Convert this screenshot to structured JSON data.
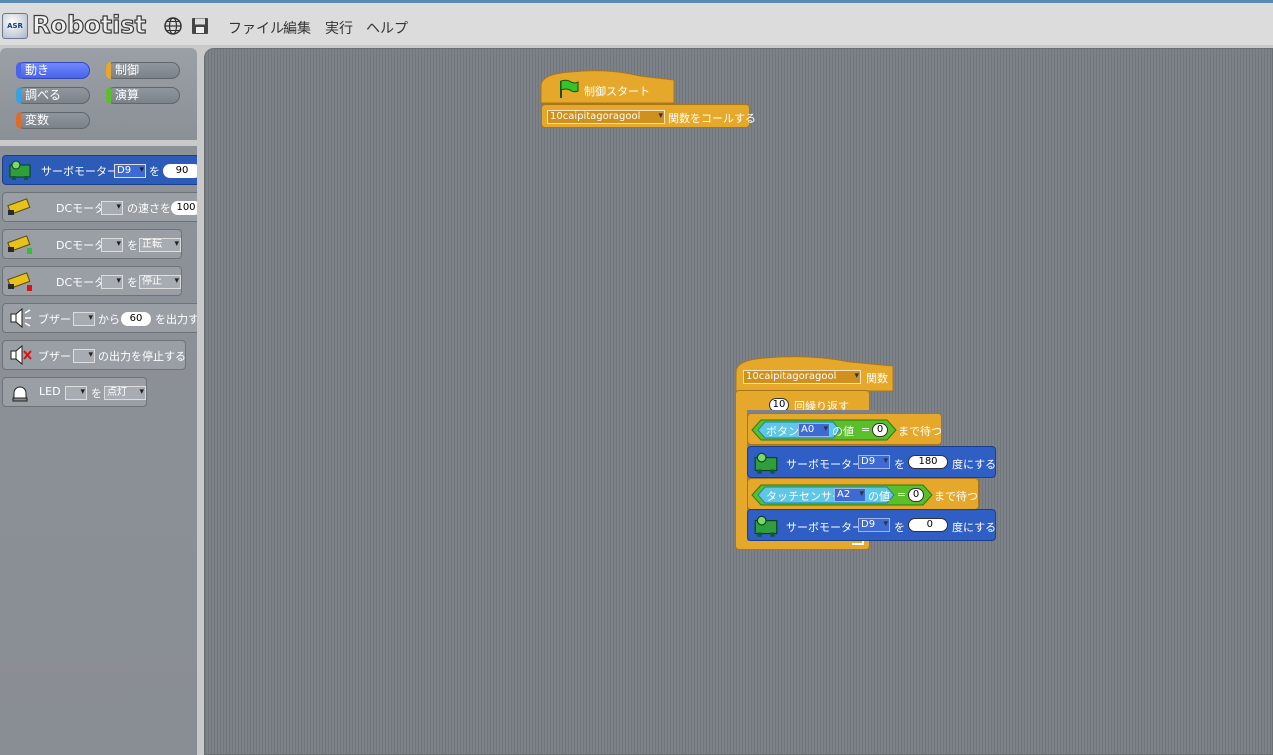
{
  "app": {
    "title": "Robotist",
    "logo_badge": "ASR"
  },
  "menu": [
    "ファイル",
    "編集",
    "実行",
    "ヘルプ"
  ],
  "categories": [
    {
      "label": "動き",
      "color": "#4a64e8",
      "active": true
    },
    {
      "label": "制御",
      "color": "#e6a82a",
      "active": false
    },
    {
      "label": "調べる",
      "color": "#3aa0e0",
      "active": false
    },
    {
      "label": "演算",
      "color": "#5bbf2b",
      "active": false
    },
    {
      "label": "変数",
      "color": "#e06a2a",
      "active": false
    }
  ],
  "palette": {
    "servo": {
      "label": "サーボモーター",
      "port": "D9",
      "wo": "を",
      "value": "90"
    },
    "dc_speed": {
      "label": "DCモーター",
      "port": "",
      "suffix": "の速さを",
      "value": "100"
    },
    "dc_forward": {
      "label": "DCモーター",
      "port": "",
      "wo": "を",
      "mode": "正転"
    },
    "dc_stop": {
      "label": "DCモーター",
      "port": "",
      "wo": "を",
      "mode": "停止"
    },
    "buzzer": {
      "label": "ブザー",
      "port": "",
      "kara": "から",
      "tone": "60",
      "suffix": "を出力す"
    },
    "buzzer_stop": {
      "label": "ブザー",
      "port": "",
      "suffix": "の出力を停止する"
    },
    "led": {
      "label": "LED",
      "port": "",
      "wo": "を",
      "mode": "点灯"
    }
  },
  "script1": {
    "hat": "制御スタート",
    "func_name": "10caipitagoragool",
    "call_label": "関数をコールする"
  },
  "script2": {
    "func_name": "10caipitagoragool",
    "func_label": "関数",
    "repeat_count": "10",
    "repeat_label": "回繰り返す",
    "wait1": {
      "sensor": "ボタン",
      "port": "A0",
      "no_value": "の値",
      "eq": "=",
      "value": "0",
      "until": "まで待つ"
    },
    "servo1": {
      "label": "サーボモーター",
      "port": "D9",
      "wo": "を",
      "value": "180",
      "suffix": "度にする"
    },
    "wait2": {
      "sensor": "タッチセンサー",
      "port": "A2",
      "no_value": "の値",
      "eq": "=",
      "value": "0",
      "until": "まで待つ"
    },
    "servo2": {
      "label": "サーボモーター",
      "port": "D9",
      "wo": "を",
      "value": "0",
      "suffix": "度にする"
    }
  }
}
